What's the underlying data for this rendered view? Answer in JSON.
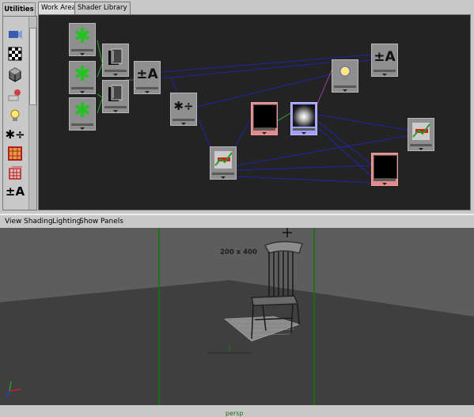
{
  "hypershade": {
    "utilities_label": "Utilities",
    "tabs": [
      {
        "label": "Work Area"
      },
      {
        "label": "Shader Library"
      }
    ],
    "shelf_icons": [
      "camera-icon",
      "checker-icon",
      "cube-icon",
      "light-icon",
      "lightbulb-icon",
      "multiply-divide-icon",
      "grid-icon",
      "cube-grid-icon",
      "plus-minus-icon"
    ],
    "symbols": {
      "plus_minus": "±A",
      "mult_div": "✱÷",
      "spark": "✱"
    }
  },
  "viewport": {
    "menu": [
      "View",
      "Shading",
      "Lighting",
      "Show",
      "Panels"
    ],
    "resolution": "200 x 400",
    "camera": "persp"
  },
  "colors": {
    "accent": "#2a2aa0",
    "link_blue": "#2323a8",
    "link_green": "#2faf2f",
    "link_purple": "#9a3fa0",
    "node_pink": "#e48a8a",
    "node_lilac": "#a0a0ff"
  }
}
